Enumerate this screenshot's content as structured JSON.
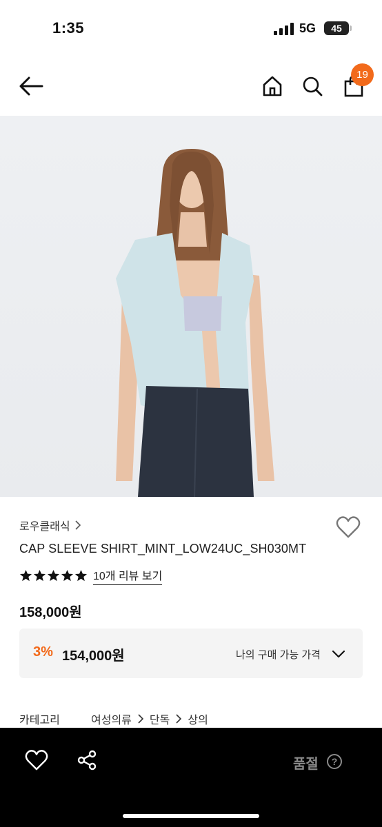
{
  "status_bar": {
    "time": "1:35",
    "network": "5G",
    "battery": "45"
  },
  "nav": {
    "cart_count": "19"
  },
  "product": {
    "brand": "로우클래식",
    "name": "CAP SLEEVE SHIRT_MINT_LOW24UC_SH030MT",
    "rating_stars": 5,
    "review_link": "10개 리뷰 보기",
    "price": "158,000원"
  },
  "my_price": {
    "discount_rate": "3%",
    "discount_price": "154,000원",
    "label": "나의 구매 가능 가격"
  },
  "category": {
    "label": "카테고리",
    "crumbs": [
      "여성의류",
      "단독",
      "상의"
    ]
  },
  "bottom_bar": {
    "status": "품절"
  },
  "colors": {
    "accent": "#f26a1b",
    "bottom_bar": "#000000",
    "price_box": "#f4f4f4"
  }
}
